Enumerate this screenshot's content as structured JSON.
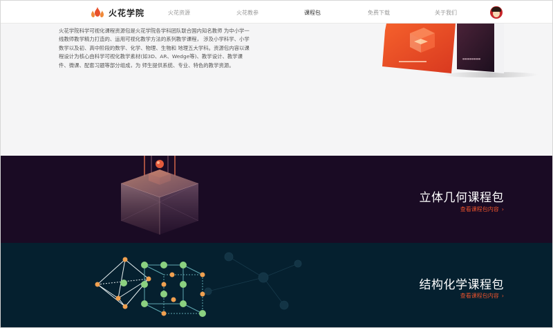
{
  "nav": {
    "logo_text": "火花学院",
    "items": [
      "火花资源",
      "火花教参",
      "课程包",
      "免费下载",
      "关于我们"
    ],
    "active_index": 2
  },
  "intro": {
    "text": "火花学院科学可视化课程资源包是火花学院各学科团队联合国内知名教师 为中小学一线教师教学精力打造的、运用可视化教学方法的系列教学课程， 涉及小学科学、小学数学以及初、高中阶段的数学、化学、物理、生物和 地理五大学科。资源包内容以课程设计为核心由科学可视化教学素材(如3D、AR、Wedge等)、教学设计、教学课件、微课、配套习题等部分组成，为 师生提供系统、专业、特色的教学资源。"
  },
  "banners": [
    {
      "title": "立体几何课程包",
      "link": "查看课程包内容"
    },
    {
      "title": "结构化学课程包",
      "link": "查看课程包内容"
    }
  ],
  "colors": {
    "accent": "#e8512c",
    "geo_bg": "#1a0b24",
    "chem_bg": "#05202f"
  },
  "icons": {
    "logo": "flame-logo-icon",
    "avatar": "user-avatar",
    "chevron": "chevron-right-icon"
  }
}
